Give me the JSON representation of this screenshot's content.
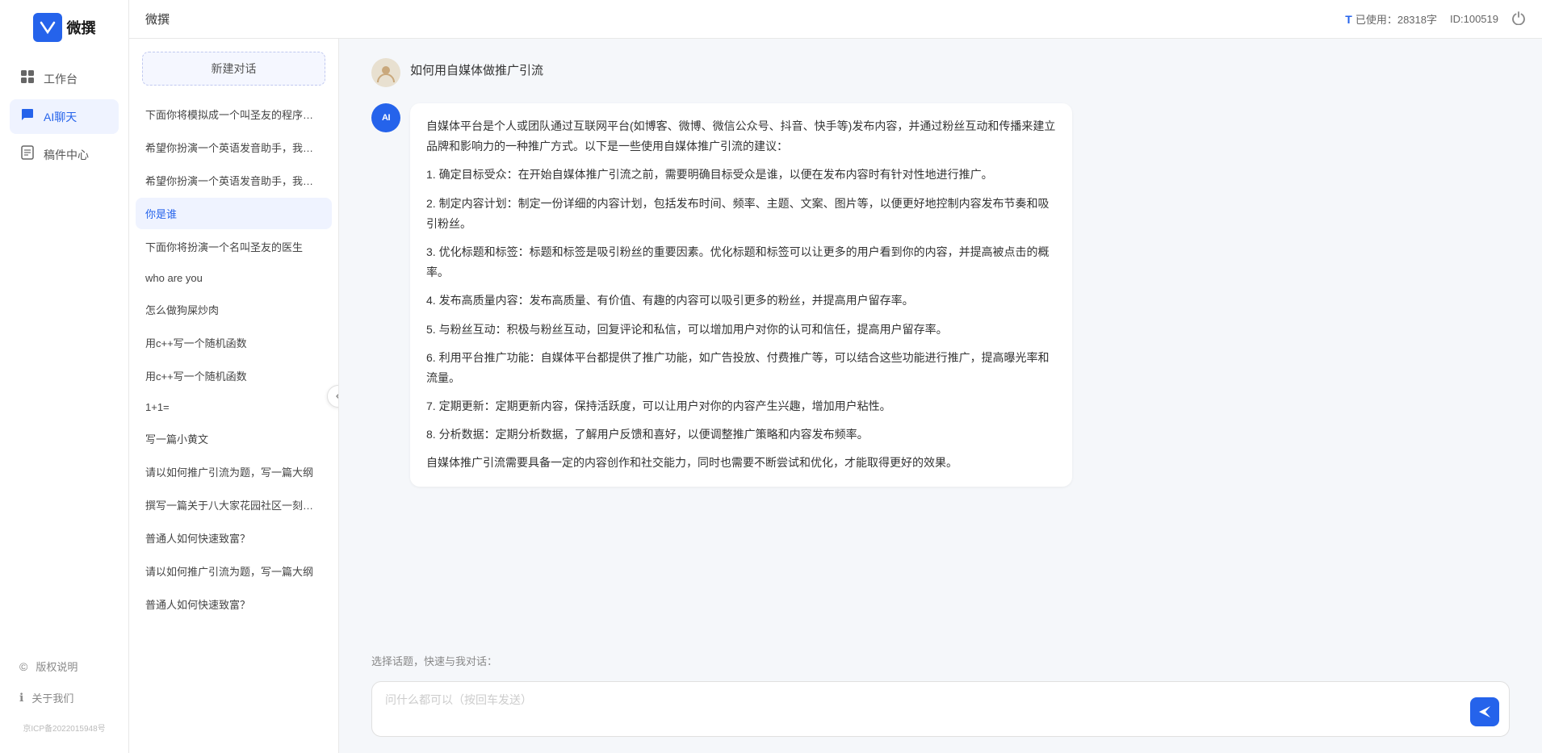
{
  "app": {
    "name": "微撰",
    "logo_letter": "W",
    "header_title": "微撰",
    "usage_label": "已使用：28318字",
    "id_label": "ID:100519",
    "power_icon": "power"
  },
  "nav": {
    "items": [
      {
        "id": "workbench",
        "label": "工作台",
        "icon": "🖥"
      },
      {
        "id": "ai-chat",
        "label": "AI聊天",
        "icon": "💬",
        "active": true
      },
      {
        "id": "drafts",
        "label": "稿件中心",
        "icon": "📄"
      }
    ],
    "bottom": [
      {
        "id": "copyright",
        "label": "版权说明",
        "icon": "©"
      },
      {
        "id": "about",
        "label": "关于我们",
        "icon": "ℹ"
      }
    ],
    "icp": "京ICP备2022015948号"
  },
  "conv_list": {
    "new_btn": "新建对话",
    "items": [
      {
        "id": 1,
        "text": "下面你将模拟成一个叫圣友的程序员，我说..."
      },
      {
        "id": 2,
        "text": "希望你扮演一个英语发音助手，我提供给你..."
      },
      {
        "id": 3,
        "text": "希望你扮演一个英语发音助手，我提供给你..."
      },
      {
        "id": 4,
        "text": "你是谁",
        "active": true
      },
      {
        "id": 5,
        "text": "下面你将扮演一个名叫圣友的医生"
      },
      {
        "id": 6,
        "text": "who are you"
      },
      {
        "id": 7,
        "text": "怎么做狗屎炒肉"
      },
      {
        "id": 8,
        "text": "用c++写一个随机函数"
      },
      {
        "id": 9,
        "text": "用c++写一个随机函数"
      },
      {
        "id": 10,
        "text": "1+1="
      },
      {
        "id": 11,
        "text": "写一篇小黄文"
      },
      {
        "id": 12,
        "text": "请以如何推广引流为题，写一篇大纲"
      },
      {
        "id": 13,
        "text": "撰写一篇关于八大家花园社区一刻钟便民生..."
      },
      {
        "id": 14,
        "text": "普通人如何快速致富？"
      },
      {
        "id": 15,
        "text": "请以如何推广引流为题，写一篇大纲"
      },
      {
        "id": 16,
        "text": "普通人如何快速致富？"
      }
    ]
  },
  "chat": {
    "user_msg": "如何用自媒体做推广引流",
    "ai_response": {
      "paragraphs": [
        "自媒体平台是个人或团队通过互联网平台(如博客、微博、微信公众号、抖音、快手等)发布内容，并通过粉丝互动和传播来建立品牌和影响力的一种推广方式。以下是一些使用自媒体推广引流的建议：",
        "1. 确定目标受众：在开始自媒体推广引流之前，需要明确目标受众是谁，以便在发布内容时有针对性地进行推广。",
        "2. 制定内容计划：制定一份详细的内容计划，包括发布时间、频率、主题、文案、图片等，以便更好地控制内容发布节奏和吸引粉丝。",
        "3. 优化标题和标签：标题和标签是吸引粉丝的重要因素。优化标题和标签可以让更多的用户看到你的内容，并提高被点击的概率。",
        "4. 发布高质量内容：发布高质量、有价值、有趣的内容可以吸引更多的粉丝，并提高用户留存率。",
        "5. 与粉丝互动：积极与粉丝互动，回复评论和私信，可以增加用户对你的认可和信任，提高用户留存率。",
        "6. 利用平台推广功能：自媒体平台都提供了推广功能，如广告投放、付费推广等，可以结合这些功能进行推广，提高曝光率和流量。",
        "7. 定期更新：定期更新内容，保持活跃度，可以让用户对你的内容产生兴趣，增加用户粘性。",
        "8. 分析数据：定期分析数据，了解用户反馈和喜好，以便调整推广策略和内容发布频率。",
        "自媒体推广引流需要具备一定的内容创作和社交能力，同时也需要不断尝试和优化，才能取得更好的效果。"
      ]
    },
    "quick_prompt_label": "选择话题，快速与我对话：",
    "input_placeholder": "问什么都可以（按回车发送）",
    "send_icon": "➤"
  }
}
